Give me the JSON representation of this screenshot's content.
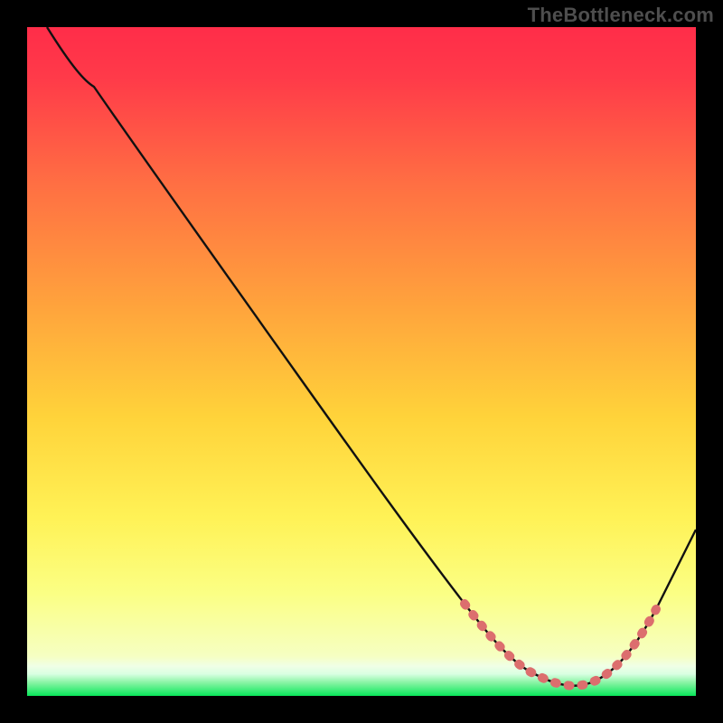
{
  "watermark": {
    "text": "TheBottleneck.com"
  },
  "chart_data": {
    "type": "line",
    "title": "",
    "xlabel": "",
    "ylabel": "",
    "xlim": [
      0,
      100
    ],
    "ylim": [
      0,
      100
    ],
    "grid": false,
    "legend": false,
    "background_gradient": {
      "top": "#ff2d49",
      "mid_upper": "#ff8b3f",
      "mid": "#ffd33a",
      "mid_lower": "#fffb6b",
      "near_bottom": "#f5ffd0",
      "bottom": "#09e75a"
    },
    "series": [
      {
        "name": "bottleneck-curve",
        "color": "#111111",
        "stroke_width": 2,
        "x": [
          3,
          10,
          20,
          30,
          40,
          50,
          60,
          66,
          70,
          74,
          78,
          82,
          86,
          90,
          94,
          100
        ],
        "values": [
          100,
          91,
          78,
          64,
          51,
          37,
          23,
          14,
          8,
          4,
          2,
          1,
          2,
          6,
          13,
          25
        ]
      }
    ],
    "highlight_segment": {
      "name": "optimal-range-dots",
      "color": "#dc6e6e",
      "stroke_width": 7,
      "linecap": "round",
      "dash": "2 12",
      "x": [
        66,
        70,
        74,
        78,
        82,
        86,
        90,
        94
      ],
      "values": [
        14,
        8,
        4,
        2,
        1,
        2,
        6,
        13
      ]
    }
  }
}
